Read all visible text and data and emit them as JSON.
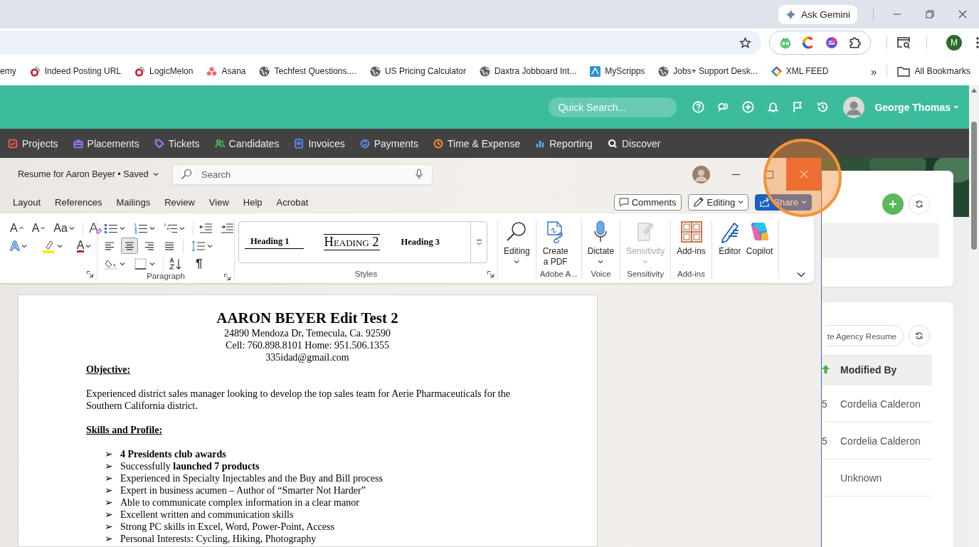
{
  "browser": {
    "ask_gemini": "Ask Gemini",
    "profile_initial": "M",
    "bookmarks": [
      {
        "label": "emy"
      },
      {
        "label": "Indeed Posting URL",
        "kind": "ring"
      },
      {
        "label": "LogicMelon",
        "kind": "ring"
      },
      {
        "label": "Asana",
        "kind": "dots"
      },
      {
        "label": "Techfest Questions....",
        "kind": "globe"
      },
      {
        "label": "US Pricing Calculator",
        "kind": "globe"
      },
      {
        "label": "Daxtra Jobboard Int...",
        "kind": "globe"
      },
      {
        "label": "MyScripps",
        "kind": "square"
      },
      {
        "label": "Jobs+ Support Desk...",
        "kind": "globe"
      },
      {
        "label": "XML FEED",
        "kind": "diamond"
      }
    ],
    "more": "»",
    "all_bookmarks": "All Bookmarks"
  },
  "app": {
    "search_placeholder": "Quick Search...",
    "user_name": "George Thomas",
    "nav": [
      {
        "label": "Projects",
        "kind": "checkbox",
        "color": "#e8574a"
      },
      {
        "label": "Placements",
        "kind": "briefcase",
        "color": "#9b72e6"
      },
      {
        "label": "Tickets",
        "kind": "tag",
        "color": "#a478ea"
      },
      {
        "label": "Candidates",
        "kind": "people",
        "color": "#4cae5a"
      },
      {
        "label": "Invoices",
        "kind": "doc",
        "color": "#5b7fe6"
      },
      {
        "label": "Payments",
        "kind": "coins",
        "color": "#5b86e6"
      },
      {
        "label": "Time & Expense",
        "kind": "clock",
        "color": "#f08a3c"
      },
      {
        "label": "Reporting",
        "kind": "chart",
        "color": "#5fa8e8"
      },
      {
        "label": "Discover",
        "kind": "search",
        "color": "#ffffff"
      }
    ]
  },
  "word": {
    "title": "Resume for Aaron Beyer • Saved",
    "search_placeholder": "Search",
    "menu": [
      "Layout",
      "References",
      "Mailings",
      "Review",
      "View",
      "Help",
      "Acrobat"
    ],
    "comments": "Comments",
    "mode": "Editing",
    "share": "Share",
    "ribbon": {
      "font_tools": [
        {
          "kind": "grow",
          "label": "A"
        },
        {
          "kind": "shrink",
          "label": "A"
        },
        {
          "kind": "case",
          "label": "Aa"
        }
      ],
      "effect_tools": [
        {
          "kind": "effects",
          "label": "A"
        },
        {
          "kind": "highlight"
        },
        {
          "kind": "font_color",
          "label": "A"
        }
      ],
      "alignment": [
        {
          "kind": "left",
          "selected": false
        },
        {
          "kind": "center",
          "selected": true
        },
        {
          "kind": "right",
          "selected": false
        },
        {
          "kind": "justify",
          "selected": false
        }
      ],
      "pilcrow": "¶",
      "paragraph_label": "Paragraph",
      "styles": [
        {
          "kind": "heading1",
          "label": "Heading 1"
        },
        {
          "kind": "heading2",
          "label": "Heading 2"
        },
        {
          "kind": "heading3",
          "label": "Heading 3"
        }
      ],
      "styles_label": "Styles",
      "groups": [
        {
          "buttons": [
            {
              "kind": "search",
              "label": "Editing",
              "dropdown": true,
              "disabled": false
            }
          ]
        },
        {
          "label": "Adobe A...",
          "buttons": [
            {
              "kind": "pdf",
              "label": "Create a PDF",
              "dropdown": false,
              "disabled": false
            }
          ]
        },
        {
          "label": "Voice",
          "buttons": [
            {
              "kind": "mic",
              "label": "Dictate",
              "dropdown": true,
              "disabled": false
            }
          ]
        },
        {
          "label": "Sensitivity",
          "buttons": [
            {
              "kind": "tag",
              "label": "Sensitivity",
              "dropdown": true,
              "disabled": true
            }
          ]
        },
        {
          "label": "Add-ins",
          "buttons": [
            {
              "kind": "grid",
              "label": "Add-ins",
              "dropdown": false,
              "disabled": false
            }
          ]
        },
        {
          "buttons": [
            {
              "kind": "pen",
              "label": "Editor",
              "dropdown": false,
              "disabled": false
            },
            {
              "kind": "copilot",
              "label": "Copilot",
              "dropdown": false,
              "disabled": false
            }
          ]
        }
      ]
    }
  },
  "document": {
    "name": "AARON BEYER Edit Test 2",
    "contact": [
      "24890 Mendoza Dr, Temecula, Ca. 92590",
      "Cell: 760.898.8101 Home: 951.506.1355",
      "335idad@gmail.com"
    ],
    "sections": [
      {
        "heading": "Objective:",
        "paragraph": "Experienced district sales manager looking to develop the top sales team for Aerie Pharmaceuticals for the Southern California district."
      },
      {
        "heading": "Skills and Profile:",
        "bullets": [
          {
            "marker": "➢",
            "text": "4 Presidents club awards",
            "bold": true
          },
          {
            "marker": "➢",
            "text": "Successfully **launched 7 products**",
            "bold": false
          },
          {
            "marker": "➢",
            "text": "Experienced in Specialty Injectables and the Buy and Bill process",
            "bold": false
          },
          {
            "marker": "➢",
            "text": "Expert in business acumen – Author of “Smarter Not Harder”",
            "bold": false
          },
          {
            "marker": "➢",
            "text": "Able to communicate complex information in a clear manor",
            "bold": false
          },
          {
            "marker": "➢",
            "text": "Excellent written and communication skills",
            "bold": false
          },
          {
            "marker": "➢",
            "text": "Strong PC skills in Excel, Word, Power-Point, Access",
            "bold": false
          },
          {
            "marker": "➢",
            "text": "Personal Interests: Cycling, Hiking, Photography",
            "bold": false
          }
        ]
      }
    ]
  },
  "side_panel": {
    "resume_button": "te Agency Resume",
    "column": "Modified By",
    "rows": [
      {
        "column_1": "5",
        "modified_by": "Cordelia Calderon"
      },
      {
        "column_1": "5",
        "modified_by": "Cordelia Calderon"
      },
      {
        "modified_by": "Unknown"
      }
    ]
  }
}
